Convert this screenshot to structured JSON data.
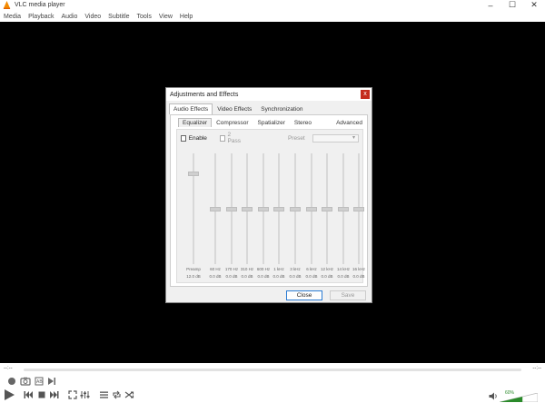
{
  "window": {
    "title": "VLC media player"
  },
  "menubar": [
    "Media",
    "Playback",
    "Audio",
    "Video",
    "Subtitle",
    "Tools",
    "View",
    "Help"
  ],
  "dialog": {
    "title": "Adjustments and Effects",
    "close_glyph": "x",
    "tabs": [
      "Audio Effects",
      "Video Effects",
      "Synchronization"
    ],
    "subtabs": [
      "Equalizer",
      "Compressor",
      "Spatializer",
      "Stereo Widener",
      "Advanced"
    ],
    "enable_label": "Enable",
    "two_pass_label": "2 Pass",
    "preset_label": "Preset",
    "preamp": {
      "label": "Preamp",
      "value": "12.0 dB",
      "level": 0.83
    },
    "bands": [
      {
        "freq": "60 Hz",
        "value": "0.0 dB",
        "level": 0.5
      },
      {
        "freq": "170 Hz",
        "value": "0.0 dB",
        "level": 0.5
      },
      {
        "freq": "310 Hz",
        "value": "0.0 dB",
        "level": 0.5
      },
      {
        "freq": "600 Hz",
        "value": "0.0 dB",
        "level": 0.5
      },
      {
        "freq": "1 kHz",
        "value": "0.0 dB",
        "level": 0.5
      },
      {
        "freq": "3 kHz",
        "value": "0.0 dB",
        "level": 0.5
      },
      {
        "freq": "6 kHz",
        "value": "0.0 dB",
        "level": 0.5
      },
      {
        "freq": "12 kHz",
        "value": "0.0 dB",
        "level": 0.5
      },
      {
        "freq": "14 kHz",
        "value": "0.0 dB",
        "level": 0.5
      },
      {
        "freq": "16 kHz",
        "value": "0.0 dB",
        "level": 0.5
      }
    ],
    "close_button": "Close",
    "save_button": "Save"
  },
  "player": {
    "time_elapsed": "--:--",
    "time_remaining": "--:--",
    "volume_percent": "60%",
    "volume_level": 0.6,
    "accent": "#2a8a2a"
  }
}
